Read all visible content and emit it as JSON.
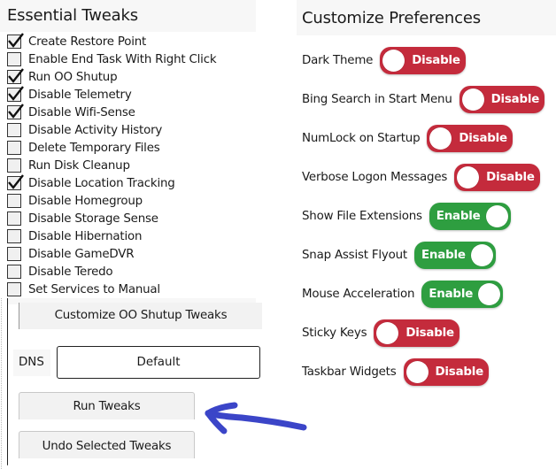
{
  "essential_tweaks": {
    "title": "Essential Tweaks",
    "items": [
      {
        "label": "Create Restore Point",
        "checked": true
      },
      {
        "label": "Enable End Task With Right Click",
        "checked": false
      },
      {
        "label": "Run OO Shutup",
        "checked": true
      },
      {
        "label": "Disable Telemetry",
        "checked": true
      },
      {
        "label": "Disable Wifi-Sense",
        "checked": true
      },
      {
        "label": "Disable Activity History",
        "checked": false
      },
      {
        "label": "Delete Temporary Files",
        "checked": false
      },
      {
        "label": "Run Disk Cleanup",
        "checked": false
      },
      {
        "label": "Disable Location Tracking",
        "checked": true
      },
      {
        "label": "Disable Homegroup",
        "checked": false
      },
      {
        "label": "Disable Storage Sense",
        "checked": false
      },
      {
        "label": "Disable Hibernation",
        "checked": false
      },
      {
        "label": "Disable GameDVR",
        "checked": false
      },
      {
        "label": "Disable Teredo",
        "checked": false
      },
      {
        "label": "Set Services to Manual",
        "checked": false
      }
    ],
    "customize_oo_label": "Customize OO Shutup Tweaks",
    "dns_label": "DNS",
    "dns_value": "Default",
    "run_label": "Run Tweaks",
    "undo_label": "Undo Selected Tweaks"
  },
  "preferences": {
    "title": "Customize Preferences",
    "items": [
      {
        "label": "Dark Theme",
        "state": "Disable",
        "on": false
      },
      {
        "label": "Bing Search in Start Menu",
        "state": "Disable",
        "on": false
      },
      {
        "label": "NumLock on Startup",
        "state": "Disable",
        "on": false
      },
      {
        "label": "Verbose Logon Messages",
        "state": "Disable",
        "on": false
      },
      {
        "label": "Show File Extensions",
        "state": "Enable",
        "on": true
      },
      {
        "label": "Snap Assist Flyout",
        "state": "Enable",
        "on": true
      },
      {
        "label": "Mouse Acceleration",
        "state": "Enable",
        "on": true
      },
      {
        "label": "Sticky Keys",
        "state": "Disable",
        "on": false
      },
      {
        "label": "Taskbar Widgets",
        "state": "Disable",
        "on": false
      }
    ]
  },
  "colors": {
    "enabled": "#2e9e40",
    "disabled": "#c42b3c",
    "annotation_arrow": "#3b45c8"
  },
  "annotation": {
    "icon": "hand-drawn-arrow-icon",
    "points_to": "Run Tweaks"
  }
}
